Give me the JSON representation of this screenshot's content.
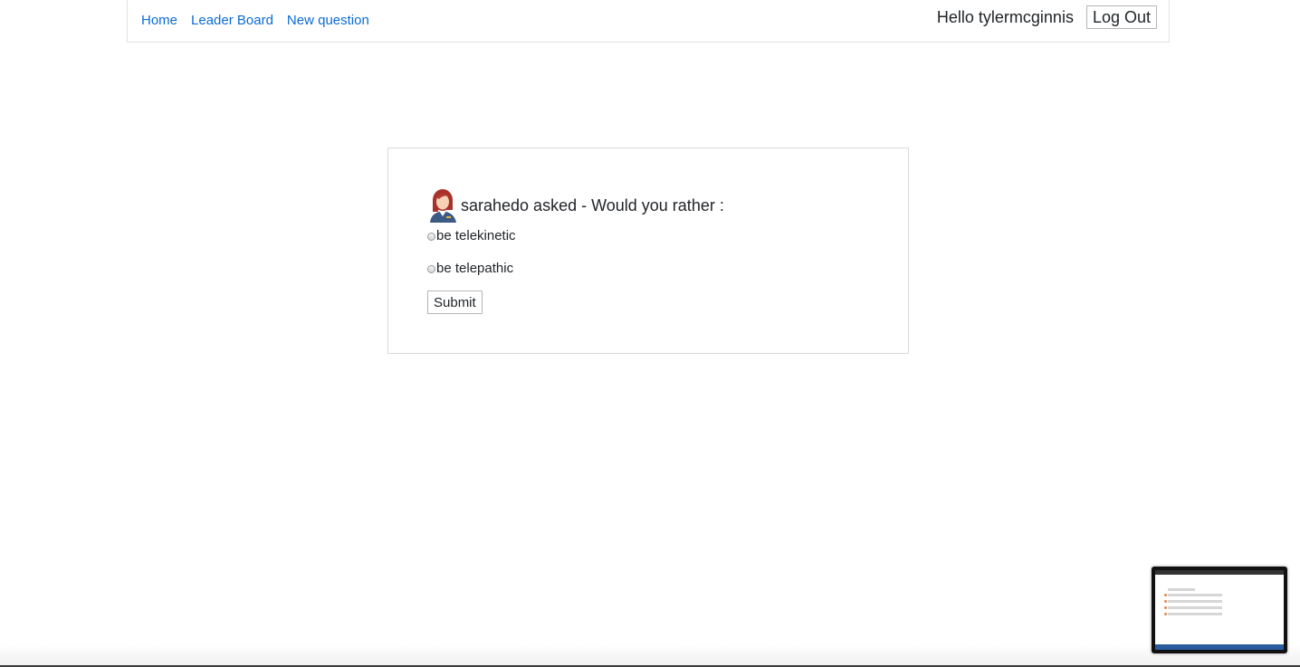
{
  "nav": {
    "links": [
      {
        "label": "Home"
      },
      {
        "label": "Leader Board"
      },
      {
        "label": "New question"
      }
    ],
    "greeting": "Hello tylermcginnis",
    "logout_label": "Log Out"
  },
  "question": {
    "title": "sarahedo asked - Would you rather :",
    "avatar_icon": "woman-avatar-icon",
    "options": [
      {
        "label": "be telekinetic",
        "selected": false
      },
      {
        "label": "be telepathic",
        "selected": false
      }
    ],
    "submit_label": "Submit"
  },
  "colors": {
    "link": "#0b6bd6",
    "text": "#212529",
    "border": "#dadada"
  }
}
